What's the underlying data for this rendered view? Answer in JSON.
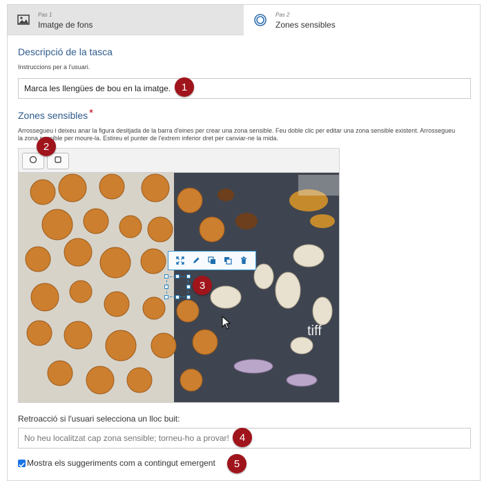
{
  "steps": [
    {
      "number_label": "Pas 1",
      "name": "Imatge de fons",
      "icon": "image-icon"
    },
    {
      "number_label": "Pas 2",
      "name": "Zones sensibles",
      "icon": "target-circle-icon"
    }
  ],
  "task_description": {
    "title": "Descripció de la tasca",
    "help": "Instruccions per a l'usuari.",
    "value": "Marca les llengües de bou en la imatge."
  },
  "hotspots": {
    "title": "Zones sensibles",
    "required_mark": "*",
    "help": "Arrossegueu i deixeu anar la figura desitjada de la barra d'eines per crear una zona sensible. Feu doble clic per editar una zona sensible existent. Arrossegueu la zona sensible per moure-la. Estireu el punter de l'extrem inferior dret per canviar-ne la mida.",
    "tools": [
      "circle-tool-icon",
      "rectangle-tool-icon"
    ],
    "hotspot_toolbar_icons": [
      "fullscreen-icon",
      "edit-icon",
      "bring-to-front-icon",
      "send-to-back-icon",
      "delete-icon"
    ]
  },
  "feedback": {
    "label": "Retroacció si l'usuari selecciona un lloc buit:",
    "placeholder": "No heu localitzat cap zona sensible; torneu-ho a provar!"
  },
  "popup_option": {
    "label": "Mostra els suggeriments com a contingut emergent",
    "checked": true
  },
  "annotations": [
    "1",
    "2",
    "3",
    "4",
    "5"
  ],
  "colors": {
    "accent": "#2e5a8c",
    "badge": "#a0141b",
    "required": "#c5000f",
    "hotspot_border": "#2a86c5",
    "checkbox": "#1a73e8"
  }
}
